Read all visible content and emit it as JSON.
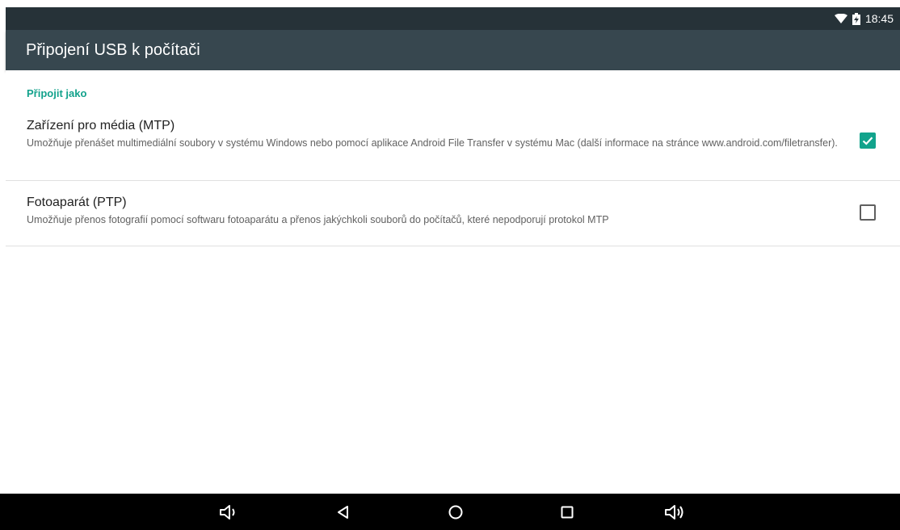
{
  "status_bar": {
    "time": "18:45",
    "icons": [
      "wifi-icon",
      "battery-charging-icon"
    ]
  },
  "app_bar": {
    "title": "Připojení USB k počítači"
  },
  "section": {
    "header": "Připojit jako"
  },
  "options": [
    {
      "title": "Zařízení pro média (MTP)",
      "summary": "Umožňuje přenášet multimediální soubory v systému Windows nebo pomocí aplikace Android File Transfer v systému Mac (další informace na stránce www.android.com/filetransfer).",
      "checked": true
    },
    {
      "title": "Fotoaparát (PTP)",
      "summary": "Umožňuje přenos fotografií pomocí softwaru fotoaparátu a přenos jakýchkoli souborů do počítačů, které nepodporují protokol MTP",
      "checked": false
    }
  ],
  "nav_bar": {
    "buttons": [
      "volume-down-icon",
      "back-icon",
      "home-icon",
      "recents-icon",
      "volume-up-icon"
    ]
  },
  "colors": {
    "accent": "#13a28c",
    "status_bar": "#263238",
    "app_bar": "#37474f"
  }
}
